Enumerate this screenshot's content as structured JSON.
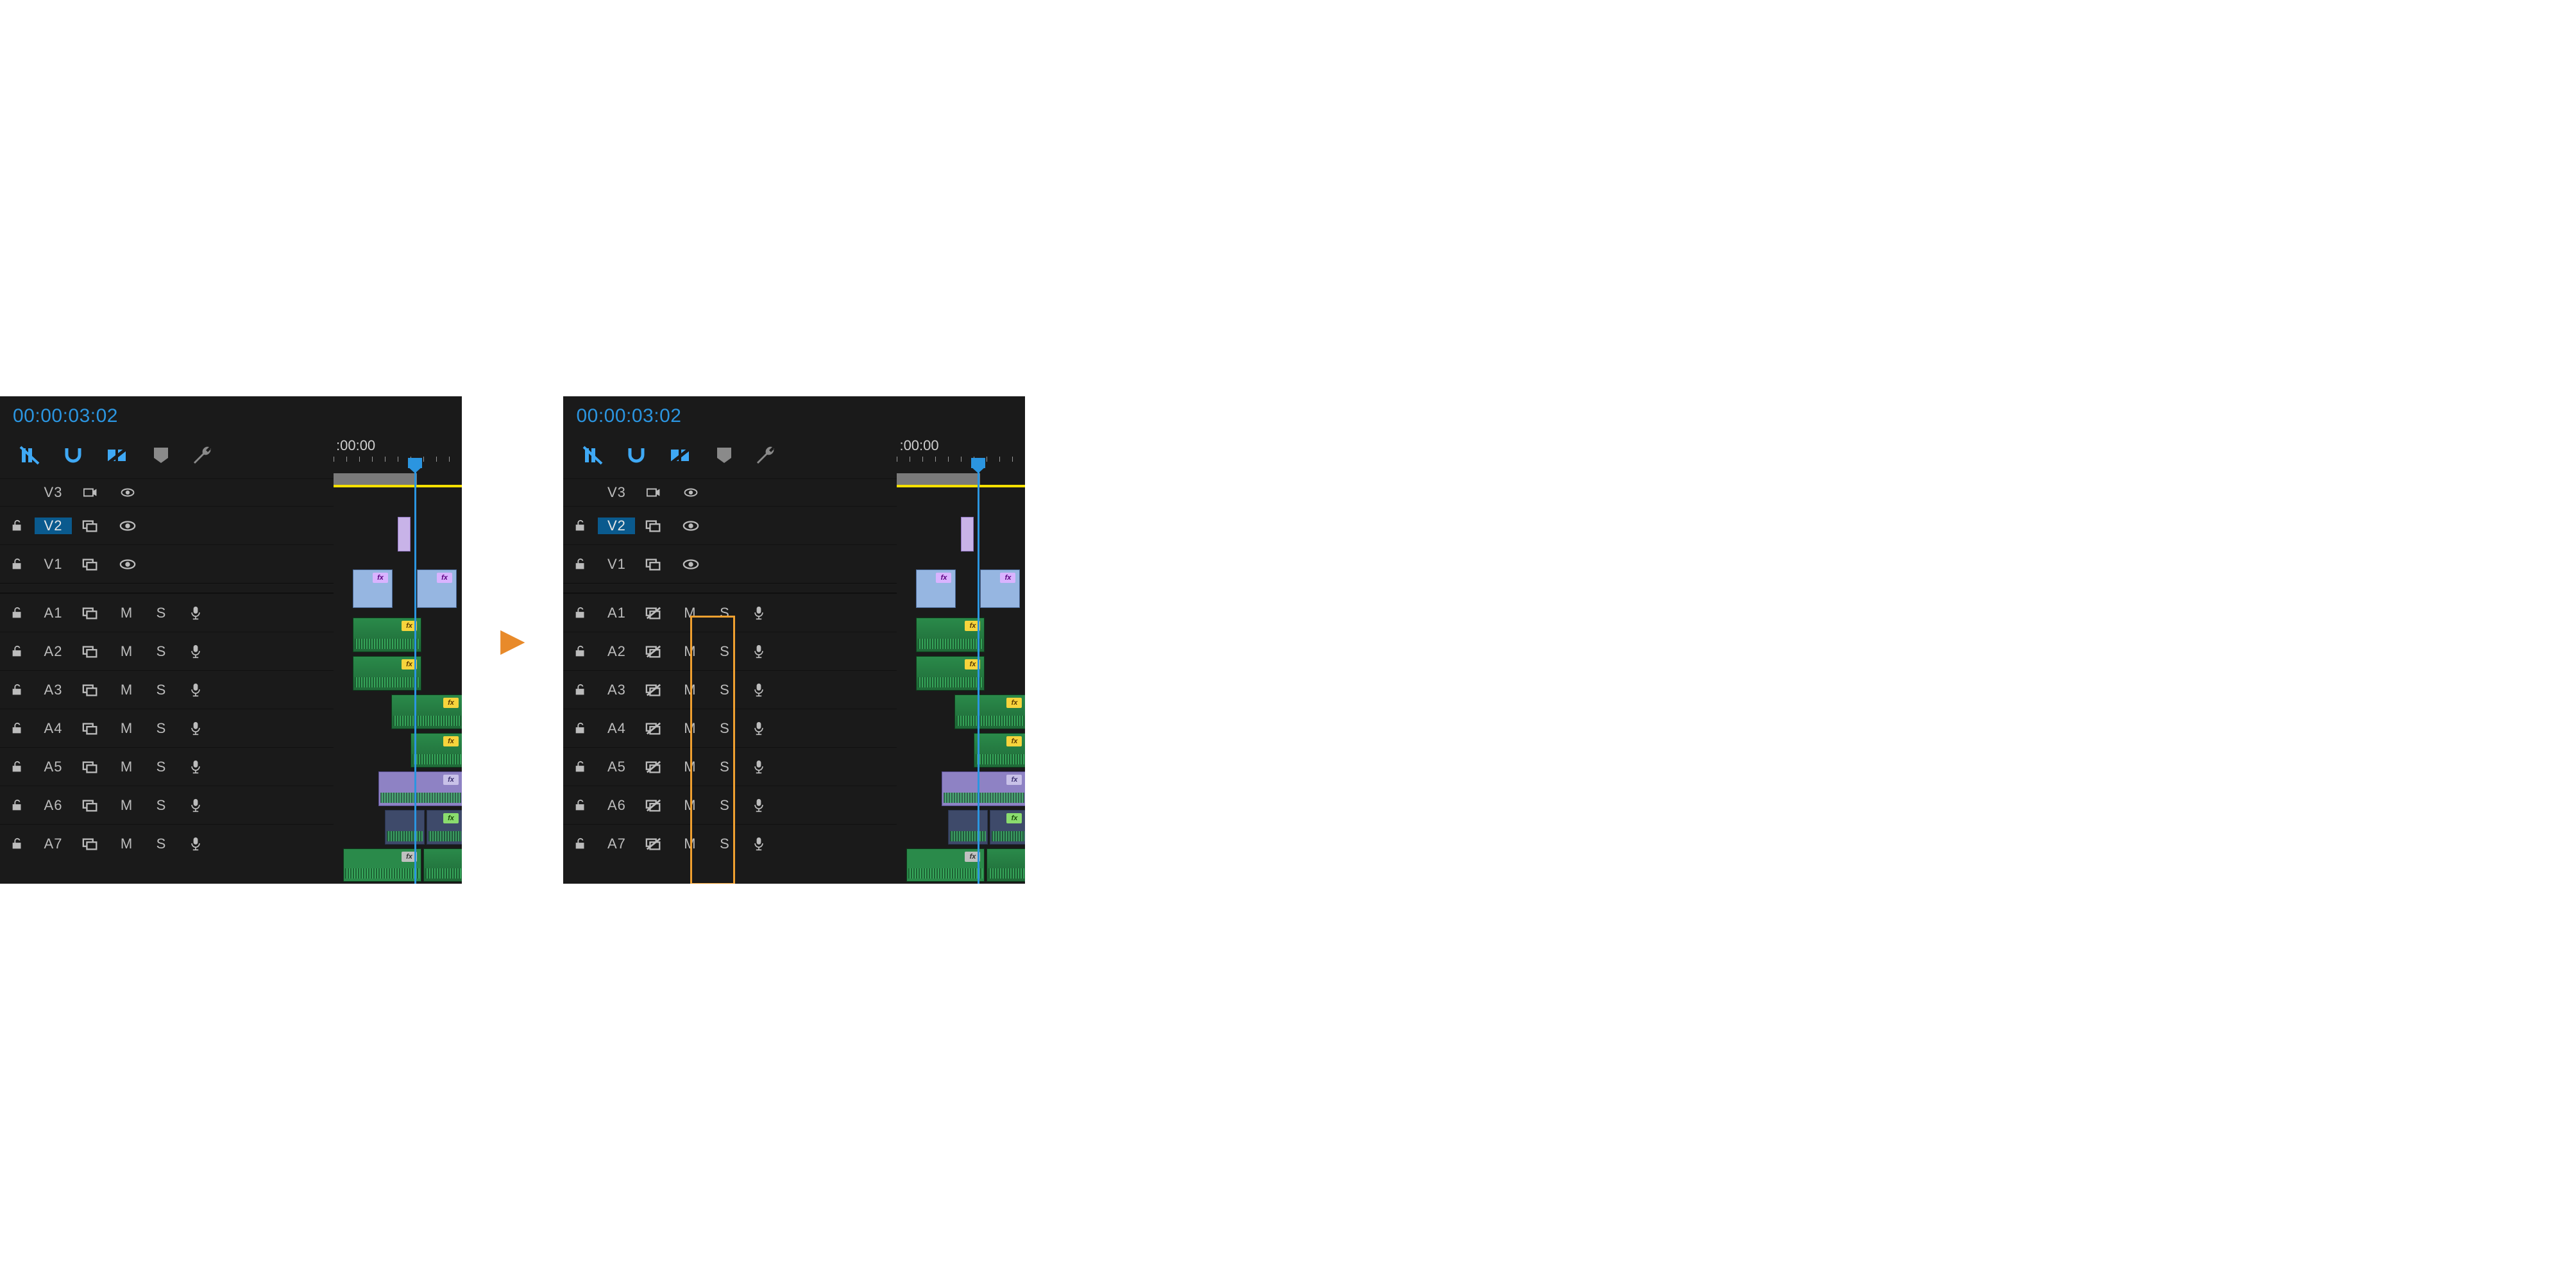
{
  "timecode": "00:00:03:02",
  "ruler_label": ":00:00",
  "toolbar": {
    "insert": "nest-or-insert",
    "snap": "snap",
    "marker": "linked-selection",
    "addmarker": "add-marker",
    "wrench": "settings"
  },
  "video_tracks": [
    {
      "id": "V3",
      "targeted": false
    },
    {
      "id": "V2",
      "targeted": true
    },
    {
      "id": "V1",
      "targeted": false
    }
  ],
  "audio_tracks": [
    {
      "id": "A1",
      "mute": "M",
      "solo": "S"
    },
    {
      "id": "A2",
      "mute": "M",
      "solo": "S"
    },
    {
      "id": "A3",
      "mute": "M",
      "solo": "S"
    },
    {
      "id": "A4",
      "mute": "M",
      "solo": "S"
    },
    {
      "id": "A5",
      "mute": "M",
      "solo": "S"
    },
    {
      "id": "A6",
      "mute": "M",
      "solo": "S"
    },
    {
      "id": "A7",
      "mute": "M",
      "solo": "S"
    }
  ],
  "fx_label": "fx",
  "panels": [
    {
      "sync_lock_state": "locked",
      "highlight_sync": false
    },
    {
      "sync_lock_state": "unlocked",
      "highlight_sync": true
    }
  ]
}
